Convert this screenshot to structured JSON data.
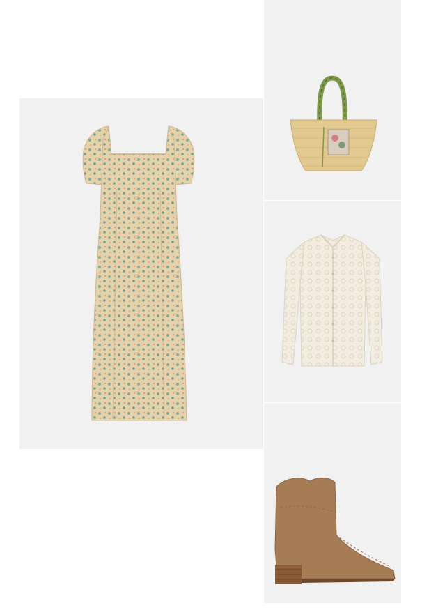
{
  "outfit": {
    "items": [
      {
        "icon": "dress-image",
        "bg_color": "#f1f1f1"
      },
      {
        "icon": "straw-bag-image",
        "bg_color": "#f1f1f1"
      },
      {
        "icon": "crochet-cardigan-image",
        "bg_color": "#f1f1f1"
      },
      {
        "icon": "suede-ankle-boot-image",
        "bg_color": "#f1f1f1"
      }
    ]
  },
  "colors": {
    "tile_background": "#f1f1f1",
    "page_background": "#ffffff",
    "dress_base": "#e6d2aa",
    "dress_print": "#7fae9a",
    "bag_straw": "#e2c98f",
    "bag_handle": "#7d9a4a",
    "cardigan": "#f2ede0",
    "boot_suede": "#a57c53",
    "boot_heel": "#8a5a34"
  }
}
